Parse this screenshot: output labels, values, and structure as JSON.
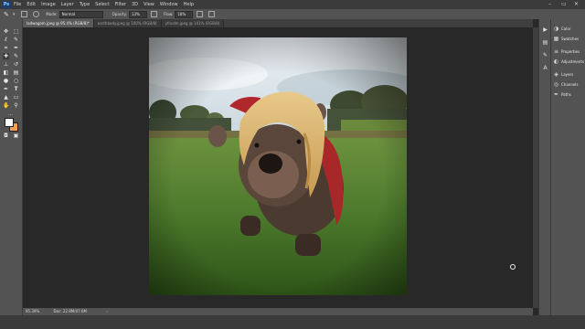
{
  "app": {
    "logo": "Ps"
  },
  "menu": [
    "File",
    "Edit",
    "Image",
    "Layer",
    "Type",
    "Select",
    "Filter",
    "3D",
    "View",
    "Window",
    "Help"
  ],
  "window_controls": {
    "minimize": "–",
    "restore": "▭",
    "close": "✕"
  },
  "options": {
    "mode_label": "Mode:",
    "mode_value": "Normal",
    "opacity_label": "Opacity:",
    "opacity_value": "13%",
    "flow_label": "Flow:",
    "flow_value": "18%"
  },
  "tabs": [
    "ladwagom.jpeg @ 95.4% (RGB/8)*",
    "earthbody.jpeg @ 100% (RGB/8)",
    "yfncdm.jpeg @ 141% (RGB/8)"
  ],
  "status": {
    "zoom": "95.39%",
    "doc": "Doc: 22.8M/47.6M"
  },
  "panels": [
    "Color",
    "Swatches",
    "Properties",
    "Adjustments",
    "Layers",
    "Channels",
    "Paths"
  ],
  "icons": {
    "tool_icons": [
      "move",
      "marquee",
      "lasso",
      "quick-select",
      "crop",
      "eyedropper",
      "healing",
      "brush",
      "stamp",
      "history",
      "eraser",
      "gradient",
      "blur",
      "dodge",
      "pen",
      "type",
      "path-select",
      "shape",
      "hand",
      "zoom"
    ]
  }
}
